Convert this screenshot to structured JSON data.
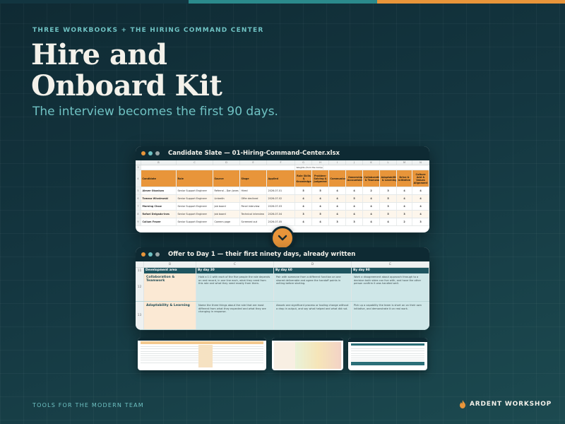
{
  "colors": {
    "accent": "#e8953a",
    "teal": "#6fc2c3",
    "navy": "#0f2a33",
    "cream": "#f3f1ea"
  },
  "hero": {
    "eyebrow": "THREE WORKBOOKS + THE HIRING COMMAND CENTER",
    "title_line1": "Hire and",
    "title_line2": "Onboard Kit",
    "subtitle": "The interview becomes the first 90 days."
  },
  "slate_window": {
    "title": "Candidate Slate — 01-Hiring-Command-Center.xlsx",
    "columns": [
      "B",
      "C",
      "D",
      "E",
      "F",
      "G",
      "H",
      "I",
      "J",
      "K",
      "L",
      "M",
      "N"
    ],
    "note_row": {
      "row": "3",
      "text": "Weights (from the Competencies tab) →"
    },
    "header_row_num": "4",
    "headers": [
      "Candidate",
      "Role",
      "Source",
      "Stage",
      "Applied",
      "Role Skills & Knowledge",
      "Problem-Solving & Judgment",
      "Communication",
      "Ownership & Accountability",
      "Collaboration & Teamwork",
      "Adaptability & Learning",
      "Drive & Initiative",
      "Culture Add & Values Alignment"
    ],
    "rows": [
      {
        "rn": "5",
        "candidate": "Aimee Okonkwo",
        "role": "Senior Support Engineer",
        "source": "Referral – Dan Jones",
        "stage": "Hired",
        "applied": "2026-07-01",
        "scores": [
          "5",
          "5",
          "4",
          "4",
          "2",
          "3",
          "4",
          "4"
        ]
      },
      {
        "rn": "6",
        "candidate": "Tomasz Wisniewski",
        "role": "Senior Support Engineer",
        "source": "LinkedIn",
        "stage": "Offer declined",
        "applied": "2026-07-02",
        "scores": [
          "4",
          "4",
          "4",
          "5",
          "4",
          "5",
          "4",
          "4"
        ]
      },
      {
        "rn": "7",
        "candidate": "Morning Chow",
        "role": "Senior Support Engineer",
        "source": "Job board",
        "stage": "Panel interview",
        "applied": "2026-07-03",
        "scores": [
          "4",
          "4",
          "4",
          "4",
          "4",
          "3",
          "4",
          "4"
        ]
      },
      {
        "rn": "8",
        "candidate": "Rafael Delgado-Ines",
        "role": "Senior Support Engineer",
        "source": "Job board",
        "stage": "Technical interview",
        "applied": "2026-07-04",
        "scores": [
          "3",
          "5",
          "4",
          "4",
          "4",
          "5",
          "3",
          "4"
        ]
      },
      {
        "rn": "9",
        "candidate": "Callum Frazer",
        "role": "Senior Support Engineer",
        "source": "Careers page",
        "stage": "Screened out",
        "applied": "2026-07-05",
        "scores": [
          "4",
          "4",
          "3",
          "3",
          "4",
          "4",
          "2",
          "3"
        ]
      }
    ]
  },
  "plan_window": {
    "title": "Offer to Day 1 — their first ninety days, already written",
    "columns": [
      "B",
      "C",
      "D",
      "E"
    ],
    "header_row_num": "11",
    "headers": [
      "Development area",
      "By day 30",
      "By day 60",
      "By day 90"
    ],
    "rows": [
      {
        "rn": "12",
        "area": "Collaboration & Teamwork",
        "d30": "Hold a 1:1 with each of the five people the role depends on and record, in one line each, what they need from this role and what they need mostly from them.",
        "d60": "Pair with someone from a different function on one shared deliverable and agree the handoff points in writing before starting.",
        "d90": "Work a disagreement about approach through to a decision both sides can live with, and have the other person confirm it was handled well."
      },
      {
        "rn": "13",
        "area": "Adaptability & Learning",
        "d30": "Name the three things about the role that are most different from what they expected and what they are changing in response.",
        "d60": "Absorb one significant process or tooling change without a drop in output, and say what helped and what did not.",
        "d90": "Pick up a capability the team is short on on their own initiative, and demonstrate it on real work."
      }
    ]
  },
  "footer": {
    "left": "TOOLS FOR THE MODERN TEAM",
    "brand": "ARDENT WORKSHOP"
  }
}
